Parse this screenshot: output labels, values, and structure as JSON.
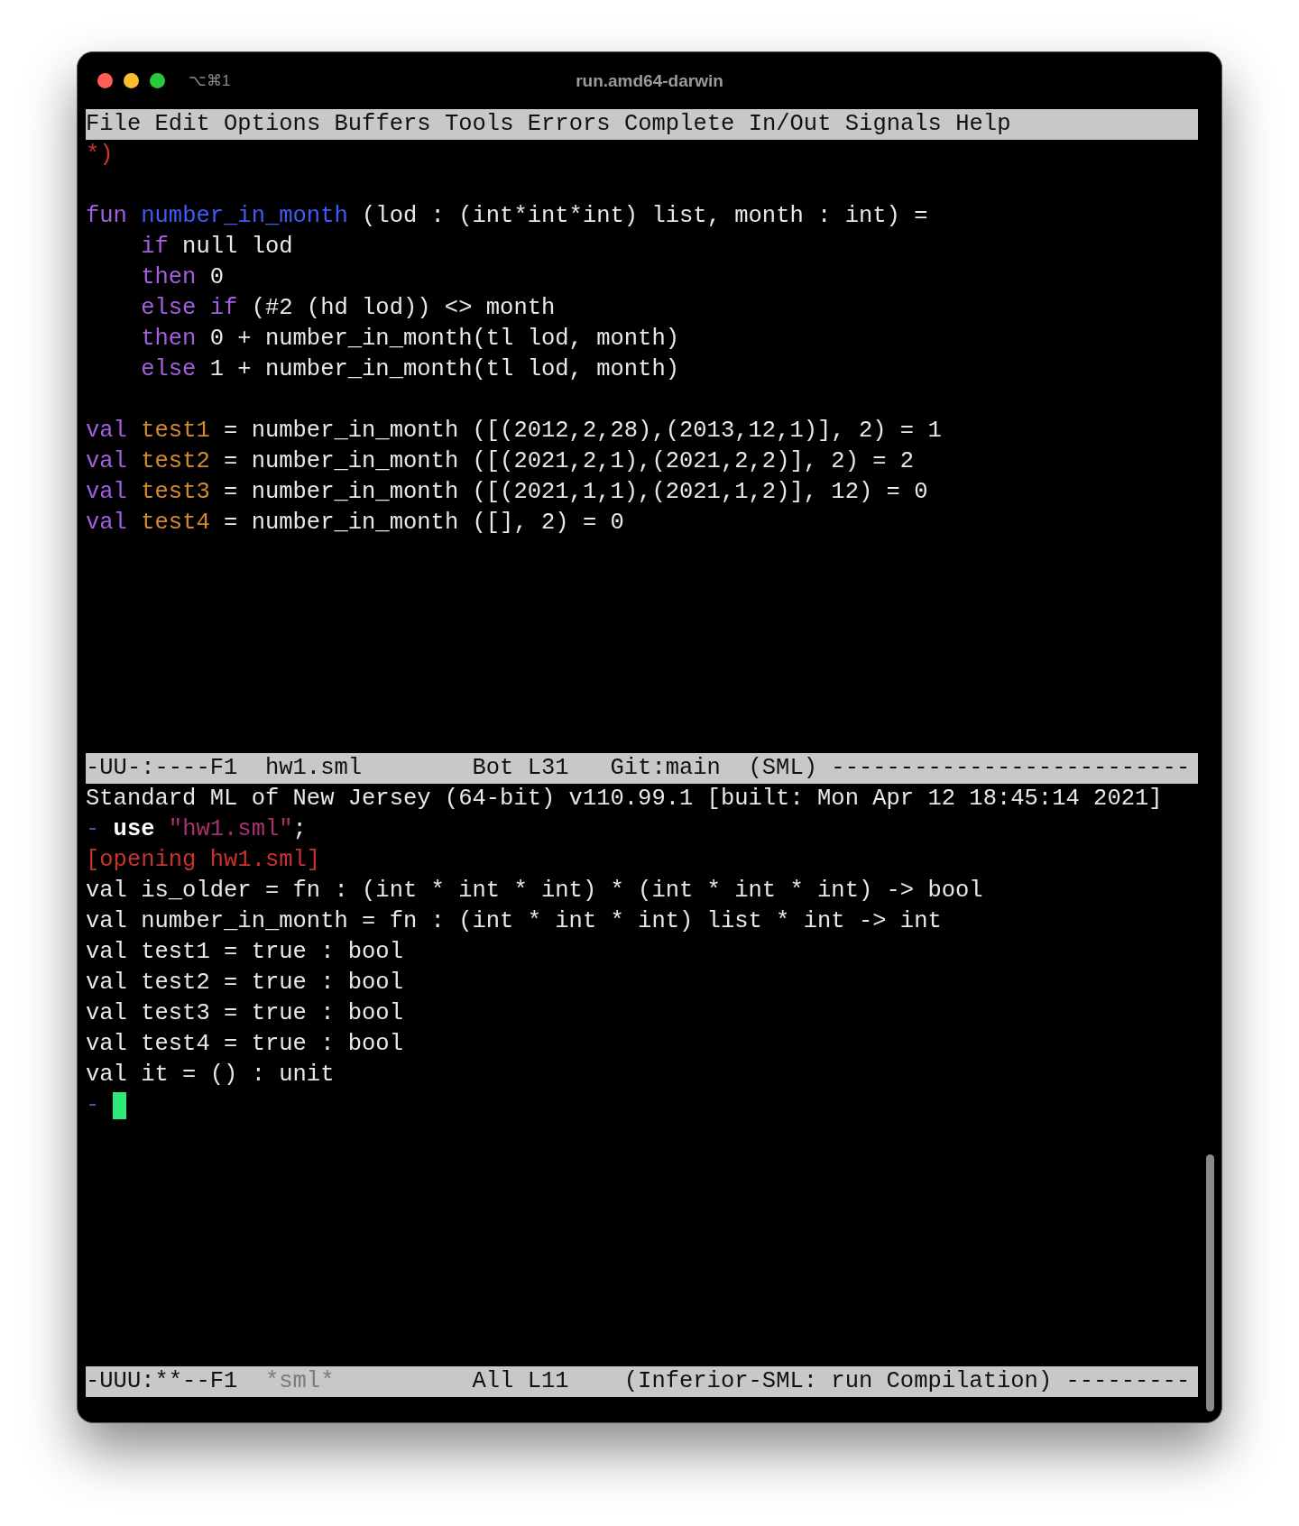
{
  "window": {
    "title": "run.amd64-darwin",
    "shortcut": "⌥⌘1"
  },
  "menu_bar": [
    "File",
    "Edit",
    "Options",
    "Buffers",
    "Tools",
    "Errors",
    "Complete",
    "In/Out",
    "Signals",
    "Help"
  ],
  "editor": {
    "lines": [
      {
        "kind": "code",
        "segments": [
          {
            "kind": "comment",
            "text": "*)"
          }
        ]
      },
      {
        "kind": "blank"
      },
      {
        "kind": "code",
        "segments": [
          {
            "kind": "keyword",
            "text": "fun"
          },
          {
            "kind": "space"
          },
          {
            "kind": "function",
            "text": "number_in_month"
          },
          {
            "kind": "plain",
            "text": " (lod : (int*int*int) list, month : int) ="
          }
        ]
      },
      {
        "kind": "code",
        "segments": [
          {
            "kind": "indent"
          },
          {
            "kind": "keyword",
            "text": "if"
          },
          {
            "kind": "plain",
            "text": " null lod"
          }
        ]
      },
      {
        "kind": "code",
        "segments": [
          {
            "kind": "indent"
          },
          {
            "kind": "keyword",
            "text": "then"
          },
          {
            "kind": "plain",
            "text": " 0"
          }
        ]
      },
      {
        "kind": "code",
        "segments": [
          {
            "kind": "indent"
          },
          {
            "kind": "keyword",
            "text": "else if"
          },
          {
            "kind": "plain",
            "text": " (#2 (hd lod)) <> month"
          }
        ]
      },
      {
        "kind": "code",
        "segments": [
          {
            "kind": "indent"
          },
          {
            "kind": "keyword",
            "text": "then"
          },
          {
            "kind": "plain",
            "text": " 0 + number_in_month(tl lod, month)"
          }
        ]
      },
      {
        "kind": "code",
        "segments": [
          {
            "kind": "indent"
          },
          {
            "kind": "keyword",
            "text": "else"
          },
          {
            "kind": "plain",
            "text": " 1 + number_in_month(tl lod, month)"
          }
        ]
      },
      {
        "kind": "blank"
      },
      {
        "kind": "code",
        "segments": [
          {
            "kind": "keyword",
            "text": "val"
          },
          {
            "kind": "space"
          },
          {
            "kind": "variable",
            "text": "test1"
          },
          {
            "kind": "plain",
            "text": " = number_in_month ([(2012,2,28),(2013,12,1)], 2) = 1"
          }
        ]
      },
      {
        "kind": "code",
        "segments": [
          {
            "kind": "keyword",
            "text": "val"
          },
          {
            "kind": "space"
          },
          {
            "kind": "variable",
            "text": "test2"
          },
          {
            "kind": "plain",
            "text": " = number_in_month ([(2021,2,1),(2021,2,2)], 2) = 2"
          }
        ]
      },
      {
        "kind": "code",
        "segments": [
          {
            "kind": "keyword",
            "text": "val"
          },
          {
            "kind": "space"
          },
          {
            "kind": "variable",
            "text": "test3"
          },
          {
            "kind": "plain",
            "text": " = number_in_month ([(2021,1,1),(2021,1,2)], 12) = 0"
          }
        ]
      },
      {
        "kind": "code",
        "segments": [
          {
            "kind": "keyword",
            "text": "val"
          },
          {
            "kind": "space"
          },
          {
            "kind": "variable",
            "text": "test4"
          },
          {
            "kind": "plain",
            "text": " = number_in_month ([], 2) = 0"
          }
        ]
      }
    ],
    "mode_line": [
      {
        "kind": "plain",
        "text": "-UU-:----F1  hw1.sml        Bot L31   Git:main  (SML) --------------------------"
      }
    ]
  },
  "repl": {
    "lines": [
      {
        "kind": "code",
        "segments": [
          {
            "kind": "plain",
            "text": "Standard ML of New Jersey (64-bit) v110.99.1 [built: Mon Apr 12 18:45:14 2021]"
          }
        ]
      },
      {
        "kind": "code",
        "segments": [
          {
            "kind": "prompt",
            "text": "-"
          },
          {
            "kind": "space"
          },
          {
            "kind": "command",
            "text": "use"
          },
          {
            "kind": "space"
          },
          {
            "kind": "string",
            "text": "\"hw1.sml\""
          },
          {
            "kind": "plain",
            "text": ";"
          }
        ]
      },
      {
        "kind": "code",
        "segments": [
          {
            "kind": "error",
            "text": "[opening hw1.sml]"
          }
        ]
      },
      {
        "kind": "code",
        "segments": [
          {
            "kind": "plain",
            "text": "val is_older = fn : (int * int * int) * (int * int * int) -> bool"
          }
        ]
      },
      {
        "kind": "code",
        "segments": [
          {
            "kind": "plain",
            "text": "val number_in_month = fn : (int * int * int) list * int -> int"
          }
        ]
      },
      {
        "kind": "code",
        "segments": [
          {
            "kind": "plain",
            "text": "val test1 = true : bool"
          }
        ]
      },
      {
        "kind": "code",
        "segments": [
          {
            "kind": "plain",
            "text": "val test2 = true : bool"
          }
        ]
      },
      {
        "kind": "code",
        "segments": [
          {
            "kind": "plain",
            "text": "val test3 = true : bool"
          }
        ]
      },
      {
        "kind": "code",
        "segments": [
          {
            "kind": "plain",
            "text": "val test4 = true : bool"
          }
        ]
      },
      {
        "kind": "code",
        "segments": [
          {
            "kind": "plain",
            "text": "val it = () : unit"
          }
        ]
      },
      {
        "kind": "prompt",
        "prompt": "-",
        "cursor": true
      }
    ],
    "mode_line": [
      {
        "kind": "plain",
        "text": "-UUU:**--F1  "
      },
      {
        "kind": "dim",
        "text": "*sml*"
      },
      {
        "kind": "plain",
        "text": "          All L11    (Inferior-SML: run Compilation) ---------"
      }
    ]
  }
}
